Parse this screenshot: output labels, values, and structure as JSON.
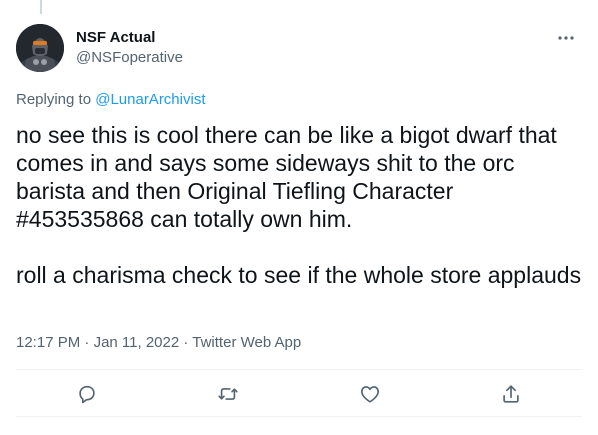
{
  "tweet": {
    "display_name": "NSF Actual",
    "handle": "@NSFoperative",
    "more_icon": "more-horizontal-icon",
    "replying_prefix": "Replying to ",
    "replying_to": "@LunarArchivist",
    "text": "no see this is cool there can be like a bigot dwarf that comes in and says some sideways shit to the orc barista and then Original Tiefling Character #453535868 can totally own him.\n\nroll a charisma check to see if the whole store applauds",
    "time": "12:17 PM",
    "separator_1": " · ",
    "date": "Jan 11, 2022",
    "separator_2": " · ",
    "source": "Twitter Web App"
  },
  "actions": {
    "reply_icon": "reply-icon",
    "retweet_icon": "retweet-icon",
    "like_icon": "heart-icon",
    "share_icon": "share-icon"
  },
  "colors": {
    "text": "#0f1419",
    "secondary": "#536471",
    "link": "#1d9bf0",
    "border": "#eff3f4"
  }
}
